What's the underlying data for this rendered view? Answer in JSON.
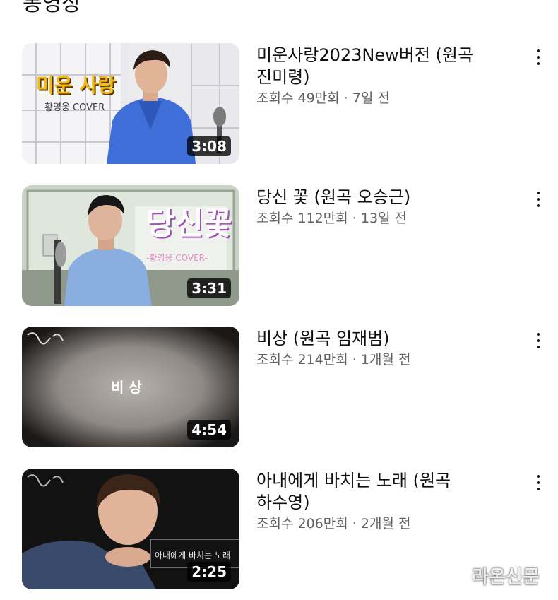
{
  "section": {
    "title": "동영상"
  },
  "videos": [
    {
      "title": "미운사랑2023New버전 (원곡 진미령)",
      "views": "조회수 49만회",
      "age": "7일 전",
      "duration": "3:08",
      "thumb_title": "미운 사랑",
      "thumb_subtitle": "황영웅 COVER"
    },
    {
      "title": "당신 꽃 (원곡 오승근)",
      "views": "조회수 112만회",
      "age": "13일 전",
      "duration": "3:31",
      "thumb_title": "당신꽃",
      "thumb_subtitle": "-황영웅 COVER-"
    },
    {
      "title": "비상 (원곡 임재범)",
      "views": "조회수 214만회",
      "age": "1개월 전",
      "duration": "4:54",
      "thumb_title": "비 상"
    },
    {
      "title": "아내에게 바치는 노래 (원곡 하수영)",
      "views": "조회수 206만회",
      "age": "2개월 전",
      "duration": "2:25",
      "thumb_title": "아내에게 바치는 노래"
    }
  ],
  "separator": "·",
  "watermark": {
    "text": "라온신문"
  },
  "icons": {
    "more": "more-vert-icon"
  },
  "colors": {
    "text": "#0f0f0f",
    "secondary": "#606060",
    "duration_bg": "#000000"
  }
}
